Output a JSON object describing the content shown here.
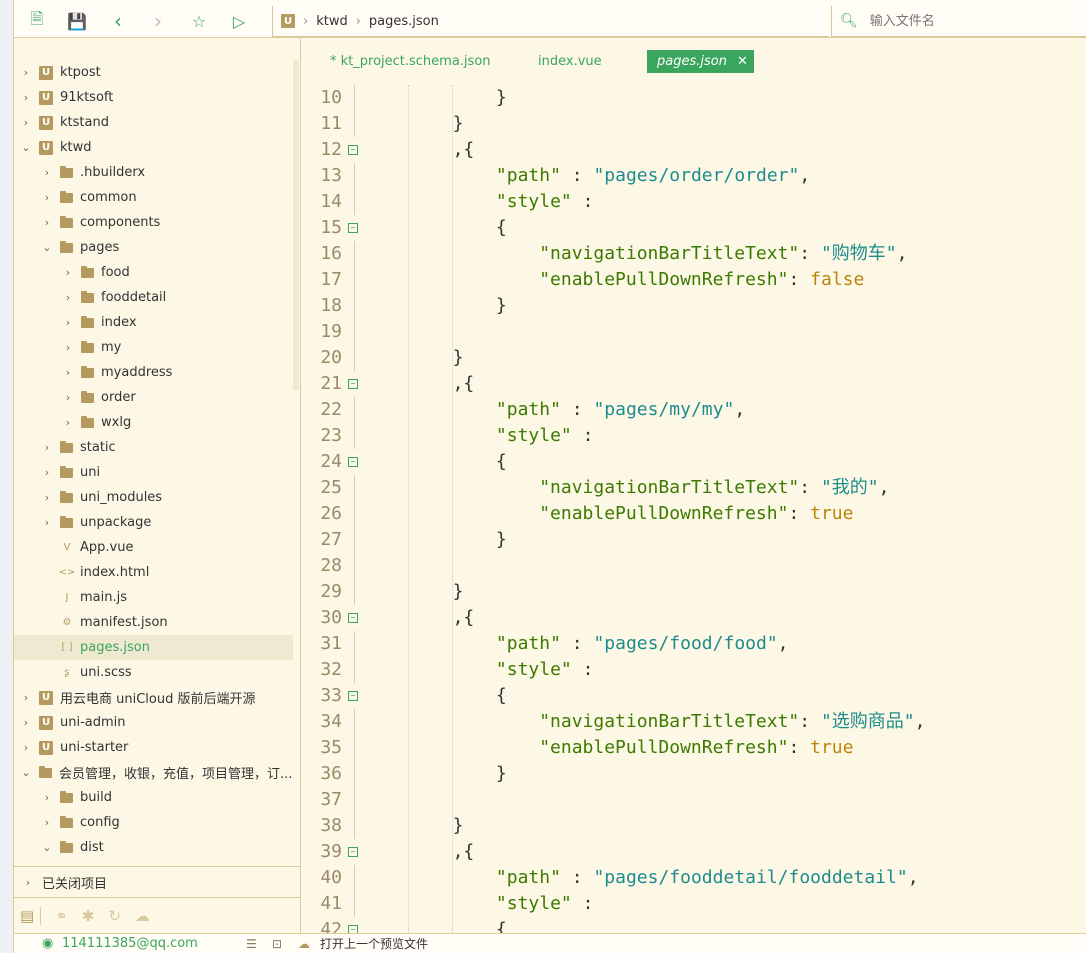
{
  "toolbar": {
    "icons": [
      "new-file-icon",
      "save-icon",
      "back-icon",
      "forward-icon",
      "star-icon",
      "run-icon"
    ]
  },
  "breadcrumb": {
    "project_icon": "U",
    "items": [
      "ktwd",
      "pages.json"
    ]
  },
  "search": {
    "placeholder": "输入文件名"
  },
  "sidebar": {
    "items": [
      {
        "depth": 0,
        "chev": "right",
        "icon": "project",
        "label": "ktpost"
      },
      {
        "depth": 0,
        "chev": "right",
        "icon": "project",
        "label": "91ktsoft"
      },
      {
        "depth": 0,
        "chev": "right",
        "icon": "project",
        "label": "ktstand"
      },
      {
        "depth": 0,
        "chev": "down",
        "icon": "project",
        "label": "ktwd"
      },
      {
        "depth": 1,
        "chev": "right",
        "icon": "folder",
        "label": ".hbuilderx"
      },
      {
        "depth": 1,
        "chev": "right",
        "icon": "folder",
        "label": "common"
      },
      {
        "depth": 1,
        "chev": "right",
        "icon": "folder",
        "label": "components"
      },
      {
        "depth": 1,
        "chev": "down",
        "icon": "folder",
        "label": "pages"
      },
      {
        "depth": 2,
        "chev": "right",
        "icon": "folder",
        "label": "food"
      },
      {
        "depth": 2,
        "chev": "right",
        "icon": "folder",
        "label": "fooddetail"
      },
      {
        "depth": 2,
        "chev": "right",
        "icon": "folder",
        "label": "index"
      },
      {
        "depth": 2,
        "chev": "right",
        "icon": "folder",
        "label": "my"
      },
      {
        "depth": 2,
        "chev": "right",
        "icon": "folder",
        "label": "myaddress"
      },
      {
        "depth": 2,
        "chev": "right",
        "icon": "folder",
        "label": "order"
      },
      {
        "depth": 2,
        "chev": "right",
        "icon": "folder",
        "label": "wxlg"
      },
      {
        "depth": 1,
        "chev": "right",
        "icon": "folder",
        "label": "static"
      },
      {
        "depth": 1,
        "chev": "right",
        "icon": "folder",
        "label": "uni"
      },
      {
        "depth": 1,
        "chev": "right",
        "icon": "folder",
        "label": "uni_modules"
      },
      {
        "depth": 1,
        "chev": "right",
        "icon": "folder",
        "label": "unpackage"
      },
      {
        "depth": 1,
        "chev": "none",
        "icon": "vue",
        "label": "App.vue"
      },
      {
        "depth": 1,
        "chev": "none",
        "icon": "html",
        "label": "index.html"
      },
      {
        "depth": 1,
        "chev": "none",
        "icon": "js",
        "label": "main.js"
      },
      {
        "depth": 1,
        "chev": "none",
        "icon": "manifest",
        "label": "manifest.json"
      },
      {
        "depth": 1,
        "chev": "none",
        "icon": "json",
        "label": "pages.json",
        "selected": true
      },
      {
        "depth": 1,
        "chev": "none",
        "icon": "scss",
        "label": "uni.scss"
      },
      {
        "depth": 0,
        "chev": "right",
        "icon": "project",
        "label": "用云电商 uniCloud 版前后端开源"
      },
      {
        "depth": 0,
        "chev": "right",
        "icon": "project",
        "label": "uni-admin"
      },
      {
        "depth": 0,
        "chev": "right",
        "icon": "project",
        "label": "uni-starter"
      },
      {
        "depth": 0,
        "chev": "down",
        "icon": "folder-project",
        "label": "会员管理，收银，充值，项目管理，订..."
      },
      {
        "depth": 1,
        "chev": "right",
        "icon": "folder",
        "label": "build"
      },
      {
        "depth": 1,
        "chev": "right",
        "icon": "folder",
        "label": "config"
      },
      {
        "depth": 1,
        "chev": "down",
        "icon": "folder",
        "label": "dist"
      }
    ],
    "closed_projects": "已关闭项目",
    "tabs": [
      "project-explorer-icon",
      "binoculars-icon",
      "bug-icon",
      "git-icon",
      "cloud-icon"
    ]
  },
  "editor": {
    "tabs": [
      {
        "label": "* kt_project.schema.json"
      },
      {
        "label": "index.vue"
      },
      {
        "label": "pages.json",
        "active": true
      }
    ],
    "lines": [
      {
        "n": 10,
        "i": 3,
        "t": [
          [
            "p",
            "}"
          ]
        ]
      },
      {
        "n": 11,
        "i": 2,
        "t": [
          [
            "p",
            "}"
          ]
        ]
      },
      {
        "n": 12,
        "i": 2,
        "f": 1,
        "t": [
          [
            "p",
            ",{"
          ]
        ]
      },
      {
        "n": 13,
        "i": 3,
        "t": [
          [
            "k",
            "\"path\""
          ],
          [
            "p",
            " : "
          ],
          [
            "s",
            "\"pages/order/order\""
          ],
          [
            "p",
            ","
          ]
        ]
      },
      {
        "n": 14,
        "i": 3,
        "t": [
          [
            "k",
            "\"style\""
          ],
          [
            "p",
            " :"
          ]
        ]
      },
      {
        "n": 15,
        "i": 3,
        "f": 1,
        "t": [
          [
            "p",
            "{"
          ]
        ]
      },
      {
        "n": 16,
        "i": 4,
        "t": [
          [
            "k",
            "\"navigationBarTitleText\""
          ],
          [
            "p",
            ": "
          ],
          [
            "s",
            "\"购物车\""
          ],
          [
            "p",
            ","
          ]
        ]
      },
      {
        "n": 17,
        "i": 4,
        "t": [
          [
            "k",
            "\"enablePullDownRefresh\""
          ],
          [
            "p",
            ": "
          ],
          [
            "b",
            "false"
          ]
        ]
      },
      {
        "n": 18,
        "i": 3,
        "t": [
          [
            "p",
            "}"
          ]
        ]
      },
      {
        "n": 19,
        "i": 0,
        "t": []
      },
      {
        "n": 20,
        "i": 2,
        "t": [
          [
            "p",
            "}"
          ]
        ]
      },
      {
        "n": 21,
        "i": 2,
        "f": 1,
        "t": [
          [
            "p",
            ",{"
          ]
        ]
      },
      {
        "n": 22,
        "i": 3,
        "t": [
          [
            "k",
            "\"path\""
          ],
          [
            "p",
            " : "
          ],
          [
            "s",
            "\"pages/my/my\""
          ],
          [
            "p",
            ","
          ]
        ]
      },
      {
        "n": 23,
        "i": 3,
        "t": [
          [
            "k",
            "\"style\""
          ],
          [
            "p",
            " :"
          ]
        ]
      },
      {
        "n": 24,
        "i": 3,
        "f": 1,
        "t": [
          [
            "p",
            "{"
          ]
        ]
      },
      {
        "n": 25,
        "i": 4,
        "t": [
          [
            "k",
            "\"navigationBarTitleText\""
          ],
          [
            "p",
            ": "
          ],
          [
            "s",
            "\"我的\""
          ],
          [
            "p",
            ","
          ]
        ]
      },
      {
        "n": 26,
        "i": 4,
        "t": [
          [
            "k",
            "\"enablePullDownRefresh\""
          ],
          [
            "p",
            ": "
          ],
          [
            "b",
            "true"
          ]
        ]
      },
      {
        "n": 27,
        "i": 3,
        "t": [
          [
            "p",
            "}"
          ]
        ]
      },
      {
        "n": 28,
        "i": 0,
        "t": []
      },
      {
        "n": 29,
        "i": 2,
        "t": [
          [
            "p",
            "}"
          ]
        ]
      },
      {
        "n": 30,
        "i": 2,
        "f": 1,
        "t": [
          [
            "p",
            ",{"
          ]
        ]
      },
      {
        "n": 31,
        "i": 3,
        "t": [
          [
            "k",
            "\"path\""
          ],
          [
            "p",
            " : "
          ],
          [
            "s",
            "\"pages/food/food\""
          ],
          [
            "p",
            ","
          ]
        ]
      },
      {
        "n": 32,
        "i": 3,
        "t": [
          [
            "k",
            "\"style\""
          ],
          [
            "p",
            " :"
          ]
        ]
      },
      {
        "n": 33,
        "i": 3,
        "f": 1,
        "t": [
          [
            "p",
            "{"
          ]
        ]
      },
      {
        "n": 34,
        "i": 4,
        "t": [
          [
            "k",
            "\"navigationBarTitleText\""
          ],
          [
            "p",
            ": "
          ],
          [
            "s",
            "\"选购商品\""
          ],
          [
            "p",
            ","
          ]
        ]
      },
      {
        "n": 35,
        "i": 4,
        "t": [
          [
            "k",
            "\"enablePullDownRefresh\""
          ],
          [
            "p",
            ": "
          ],
          [
            "b",
            "true"
          ]
        ]
      },
      {
        "n": 36,
        "i": 3,
        "t": [
          [
            "p",
            "}"
          ]
        ]
      },
      {
        "n": 37,
        "i": 0,
        "t": []
      },
      {
        "n": 38,
        "i": 2,
        "t": [
          [
            "p",
            "}"
          ]
        ]
      },
      {
        "n": 39,
        "i": 2,
        "f": 1,
        "t": [
          [
            "p",
            ",{"
          ]
        ]
      },
      {
        "n": 40,
        "i": 3,
        "t": [
          [
            "k",
            "\"path\""
          ],
          [
            "p",
            " : "
          ],
          [
            "s",
            "\"pages/fooddetail/fooddetail\""
          ],
          [
            "p",
            ","
          ]
        ]
      },
      {
        "n": 41,
        "i": 3,
        "t": [
          [
            "k",
            "\"style\""
          ],
          [
            "p",
            " :"
          ]
        ]
      },
      {
        "n": 42,
        "i": 3,
        "f": 1,
        "t": [
          [
            "p",
            "{"
          ]
        ]
      }
    ]
  },
  "status": {
    "user": "114111385@qq.com",
    "preview": "打开上一个预览文件"
  },
  "colors": {
    "accent": "#3aa55c",
    "brand": "#b49a5e",
    "key": "#3c7a00",
    "string": "#1e8c8c",
    "boolean": "#b8860b"
  }
}
